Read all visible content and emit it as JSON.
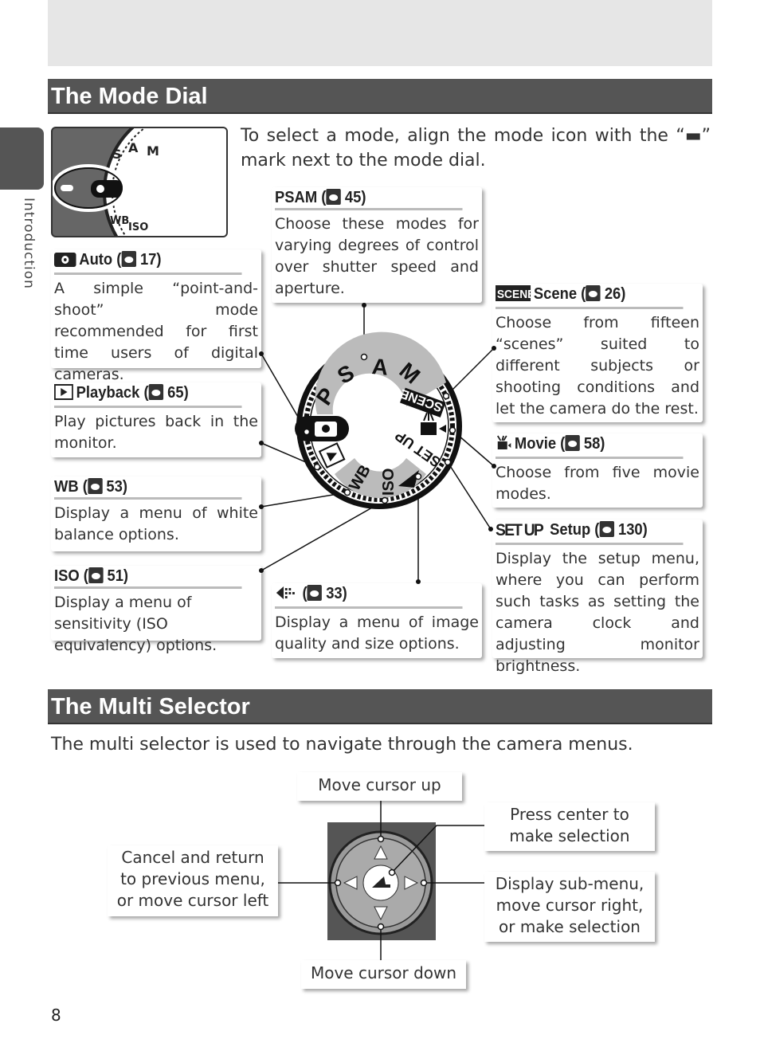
{
  "section1": {
    "title": "The Mode Dial",
    "intro": "To select a mode, align the mode icon with the “▬” mark next to the mode dial."
  },
  "sidebar": {
    "label": "Introduction"
  },
  "modes": [
    {
      "key": "auto",
      "title": "Auto (",
      "ref": "17)",
      "icon": "camera-icon",
      "text": "A simple “point-and-shoot” mode recommended for first time users of digital cameras."
    },
    {
      "key": "playback",
      "title": "Playback (",
      "ref": "65)",
      "icon": "playback-icon",
      "text": "Play pictures back in the monitor."
    },
    {
      "key": "wb",
      "title": "WB (",
      "ref": "53)",
      "icon": "",
      "text": "Display a menu of white balance options."
    },
    {
      "key": "iso",
      "title": "ISO (",
      "ref": "51)",
      "icon": "",
      "text": "Display a menu of sensitivity (ISO equivalency) options."
    },
    {
      "key": "psam",
      "title": "PSAM (",
      "ref": "45)",
      "icon": "",
      "text": "Choose these modes for varying degrees of control over shutter speed and aperture."
    },
    {
      "key": "quality",
      "title": " (",
      "ref": "33)",
      "icon": "image-quality-icon",
      "text": "Display a menu of image quality and size options."
    },
    {
      "key": "scene",
      "title": "Scene (",
      "ref": "26)",
      "icon": "scene-icon",
      "text": "Choose from fifteen “scenes” suited to different subjects or shooting conditions and let the camera do the rest."
    },
    {
      "key": "movie",
      "title": "Movie (",
      "ref": "58)",
      "icon": "movie-icon",
      "text": "Choose from five movie modes."
    },
    {
      "key": "setup",
      "title": "Setup (",
      "ref": "130)",
      "icon": "setup-icon",
      "text": "Display the setup menu, where you can perform such tasks as setting the camera clock and adjusting monitor brightness."
    }
  ],
  "dial": {
    "labels": [
      "P",
      "S",
      "A",
      "M",
      "SCENE",
      "SET UP",
      "WB",
      "ISO"
    ]
  },
  "section2": {
    "title": "The Multi Selector",
    "intro": "The multi selector is used to navigate through the camera menus."
  },
  "multi": {
    "up": "Move cursor up",
    "center": "Press center to make selection",
    "left": "Cancel and return to previous menu, or move cursor left",
    "right": "Display sub-menu, move cursor right, or make selection",
    "down": "Move cursor down"
  },
  "page": {
    "number": "8"
  }
}
